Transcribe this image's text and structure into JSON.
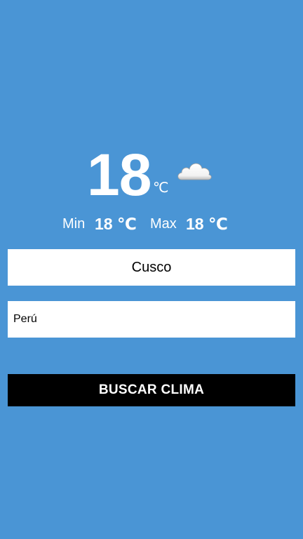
{
  "current": {
    "temperature": "18",
    "unit": "℃",
    "icon": "cloud-icon"
  },
  "range": {
    "min_label": "Min",
    "min_value": "18 ℃",
    "max_label": "Max",
    "max_value": "18 ℃"
  },
  "form": {
    "city_value": "Cusco",
    "country_value": "Perú",
    "search_label": "BUSCAR CLIMA"
  },
  "colors": {
    "background": "#4a95d5",
    "field": "#ffffff",
    "button": "#000000",
    "button_text": "#ffffff"
  }
}
